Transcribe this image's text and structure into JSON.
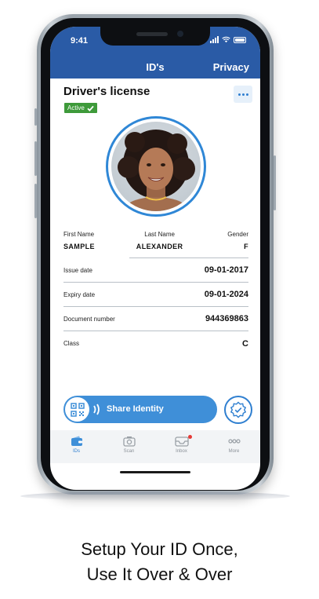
{
  "status_bar": {
    "time": "9:41"
  },
  "header": {
    "title": "ID's",
    "right_action": "Privacy"
  },
  "card": {
    "title": "Driver's license",
    "badge": "Active",
    "more_icon": "more-horizontal-icon"
  },
  "fields": {
    "first_name": {
      "label": "First Name",
      "value": "SAMPLE"
    },
    "last_name": {
      "label": "Last Name",
      "value": "ALEXANDER"
    },
    "gender": {
      "label": "Gender",
      "value": "F"
    },
    "rows": [
      {
        "label": "Issue date",
        "value": "09-01-2017"
      },
      {
        "label": "Expiry date",
        "value": "09-01-2024"
      },
      {
        "label": "Document number",
        "value": "944369863"
      },
      {
        "label": "Class",
        "value": "C"
      }
    ]
  },
  "share": {
    "label": "Share Identity",
    "icon": "qr-code-icon"
  },
  "tabs": [
    {
      "label": "IDs",
      "icon": "wallet-icon",
      "active": true
    },
    {
      "label": "Scan",
      "icon": "camera-icon",
      "active": false
    },
    {
      "label": "Inbox",
      "icon": "inbox-icon",
      "active": false
    },
    {
      "label": "More",
      "icon": "more-icon",
      "active": false
    }
  ],
  "caption": {
    "line1": "Setup Your ID Once,",
    "line2": "Use It Over & Over"
  },
  "colors": {
    "header": "#2a5ba6",
    "accent": "#3f8fd8",
    "active_badge": "#3e9a3a"
  }
}
